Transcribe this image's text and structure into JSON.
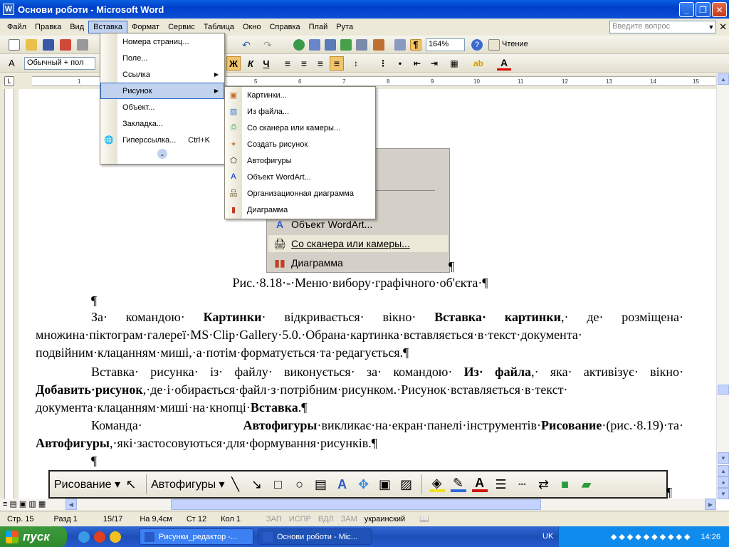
{
  "window": {
    "title": "Основи роботи - Microsoft Word"
  },
  "menubar": {
    "items": [
      "Файл",
      "Правка",
      "Вид",
      "Вставка",
      "Формат",
      "Сервис",
      "Таблица",
      "Окно",
      "Справка",
      "Плай",
      "Рута"
    ],
    "help_placeholder": "Введите вопрос"
  },
  "toolbar": {
    "zoom": "164%",
    "reading_label": "Чтение",
    "style_value": "Обычный + пол"
  },
  "ruler": {
    "h_numbers": [
      "1",
      "2",
      "3",
      "4",
      "5",
      "6",
      "7",
      "8",
      "9",
      "10",
      "11",
      "12",
      "13",
      "14",
      "15"
    ]
  },
  "insert_menu": {
    "items": [
      {
        "label": "Номера страниц..."
      },
      {
        "label": "Поле..."
      },
      {
        "label": "Ссылка"
      },
      {
        "label": "Рисунок"
      },
      {
        "label": "Объект..."
      },
      {
        "label": "Закладка..."
      },
      {
        "label": "Гиперссылка...",
        "shortcut": "Ctrl+K"
      }
    ]
  },
  "picture_submenu": {
    "items": [
      "Картинки...",
      "Из файла...",
      "Со сканера или камеры...",
      "Создать рисунок",
      "Автофигуры",
      "Объект WordArt...",
      "Организационная диаграмма",
      "Диаграмма"
    ]
  },
  "figure": {
    "rows": [
      "Объект WordArt...",
      "Со сканера или камеры...",
      "Диаграмма"
    ]
  },
  "document": {
    "caption": "Рис.·8.18·-·Меню·вибору·графічного·об'єкта·¶",
    "pilcrow": "¶",
    "p1": {
      "t1": "За· командою· ",
      "b1": "Картинки",
      "t2": "· відкривається· вікно· ",
      "b2": "Вставка· картинки",
      "t3": ",· де· розміщена· множина·піктограм·галереї·MS·Clip·Gallery·5.0.·Обрана·картинка·вставляється·в·текст·документа· подвійним·клацанням·миші,·а·потім·форматується·та·редагується.¶"
    },
    "p2": {
      "t1": "Вставка· рисунка· із· файлу· виконується· за· командою· ",
      "b1": "Из· файла",
      "t2": ",· яка· активізує· вікно· ",
      "b2": "Добавить·рисунок",
      "t3": ",·де·і·обирається·файл·з·потрібним·рисунком.·Рисунок·вставляється·в·текст· документа·клацанням·миші·на·кнопці·",
      "b3": "Вставка",
      "t4": ".¶"
    },
    "p3": {
      "t1": "Команда· ",
      "b1": "Автофигуры",
      "t2": "·викликає·на·екран·панелі·інструментів·",
      "b2": "Рисование",
      "t3": "·(рис.·8.19)·та· ",
      "b3": "Автофигуры",
      "t4": ",·які·застосовуються·для·формування·рисунків.¶"
    },
    "drawbar": {
      "draw_label": "Рисование ▾",
      "autoshapes_label": "Автофигуры ▾"
    }
  },
  "status": {
    "page": "Стр. 15",
    "section": "Разд 1",
    "pages": "15/17",
    "at": "На 9,4см",
    "line": "Ст 12",
    "col": "Кол 1",
    "rec": "ЗАП",
    "trk": "ИСПР",
    "ext": "ВДЛ",
    "ovr": "ЗАМ",
    "lang": "украинский"
  },
  "taskbar": {
    "start": "пуск",
    "tasks": [
      "Рисунки_редактор -...",
      "Основи роботи - Mic..."
    ],
    "lang": "UK",
    "clock": "14:26"
  }
}
